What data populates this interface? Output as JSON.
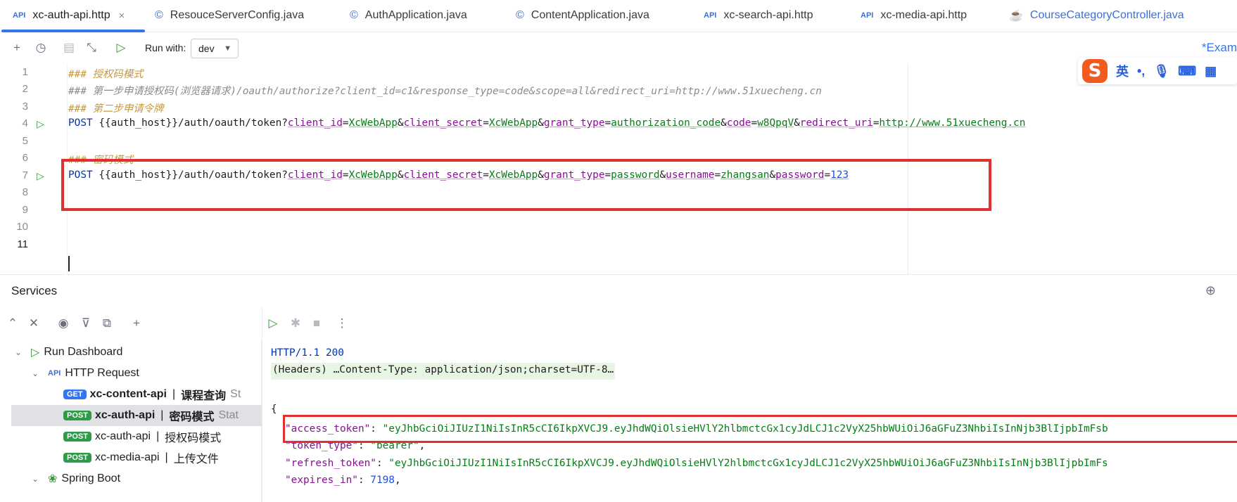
{
  "tabs": [
    {
      "label": "xc-auth-api.http",
      "icon": "API",
      "active": true,
      "close": "×"
    },
    {
      "label": "ResouceServerConfig.java",
      "icon": "java-class-icon"
    },
    {
      "label": "AuthApplication.java",
      "icon": "java-class-icon"
    },
    {
      "label": "ContentApplication.java",
      "icon": "java-class-icon"
    },
    {
      "label": "xc-search-api.http",
      "icon": "API"
    },
    {
      "label": "xc-media-api.http",
      "icon": "API"
    },
    {
      "label": "CourseCategoryController.java",
      "icon": "java-controller-icon"
    }
  ],
  "toolbar": {
    "run_with_label": "Run with:",
    "env_value": "dev",
    "example_label": "*Exam"
  },
  "ime": {
    "lang": "英",
    "punct": "•,"
  },
  "editor": {
    "line_numbers": [
      "1",
      "2",
      "3",
      "4",
      "5",
      "6",
      "7",
      "8",
      "9",
      "10",
      "11"
    ],
    "line1": "### 授权码模式",
    "line2": "### 第一步申请授权码(浏览器请求)/oauth/authorize?client_id=c1&response_type=code&scope=all&redirect_uri=http://www.51xuecheng.cn",
    "line3": "### 第二步申请令牌",
    "line4": {
      "method": "POST",
      "path": "{{auth_host}}/auth/oauth/token?",
      "params": [
        {
          "k": "client_id",
          "v": "XcWebApp"
        },
        {
          "k": "client_secret",
          "v": "XcWebApp"
        },
        {
          "k": "grant_type",
          "v": "authorization_code"
        },
        {
          "k": "code",
          "v": "w8QpqV"
        },
        {
          "k": "redirect_uri",
          "v": "http://www.51xuecheng.cn"
        }
      ]
    },
    "line6": "### 密码模式",
    "line7": {
      "method": "POST",
      "path": "{{auth_host}}/auth/oauth/token?",
      "params": [
        {
          "k": "client_id",
          "v": "XcWebApp"
        },
        {
          "k": "client_secret",
          "v": "XcWebApp"
        },
        {
          "k": "grant_type",
          "v": "password"
        },
        {
          "k": "username",
          "v": "zhangsan"
        },
        {
          "k": "password",
          "v": "123"
        }
      ]
    }
  },
  "services": {
    "title": "Services",
    "tree": [
      {
        "label": "Run Dashboard",
        "level": 0,
        "expanded": true
      },
      {
        "label": "HTTP Request",
        "level": 1,
        "expanded": true
      },
      {
        "method": "GET",
        "name": "xc-content-api",
        "desc": "课程查询",
        "tail": "St",
        "level": 2,
        "bold": true
      },
      {
        "method": "POST",
        "name": "xc-auth-api",
        "desc": "密码模式",
        "tail": "Stat",
        "level": 2,
        "bold": true,
        "selected": true
      },
      {
        "method": "POST",
        "name": "xc-auth-api",
        "desc": "授权码模式",
        "level": 2
      },
      {
        "method": "POST",
        "name": "xc-media-api",
        "desc": "上传文件",
        "level": 2
      },
      {
        "label": "Spring Boot",
        "level": 1,
        "expanded": true
      }
    ]
  },
  "output": {
    "status": "HTTP/1.1 200",
    "headers": "(Headers) …Content-Type: application/json;charset=UTF-8…",
    "open_brace": "{",
    "access_token_key": "\"access_token\"",
    "access_token_val": "\"eyJhbGciOiJIUzI1NiIsInR5cCI6IkpXVCJ9.eyJhdWQiOlsieHVlY2hlbmctcGx1cyJdLCJ1c2VyX25hbWUiOiJ6aGFuZ3NhbiIsInNjb3BlIjpbImFsb",
    "token_type_key": "\"token_type\"",
    "token_type_val": "\"bearer\"",
    "refresh_token_key": "\"refresh_token\"",
    "refresh_token_val": "\"eyJhbGciOiJIUzI1NiIsInR5cCI6IkpXVCJ9.eyJhdWQiOlsieHVlY2hlbmctcGx1cyJdLCJ1c2VyX25hbWUiOiJ6aGFuZ3NhbiIsInNjb3BlIjpbImFs",
    "expires_in_key": "\"expires_in\"",
    "expires_in_val": "7198"
  }
}
